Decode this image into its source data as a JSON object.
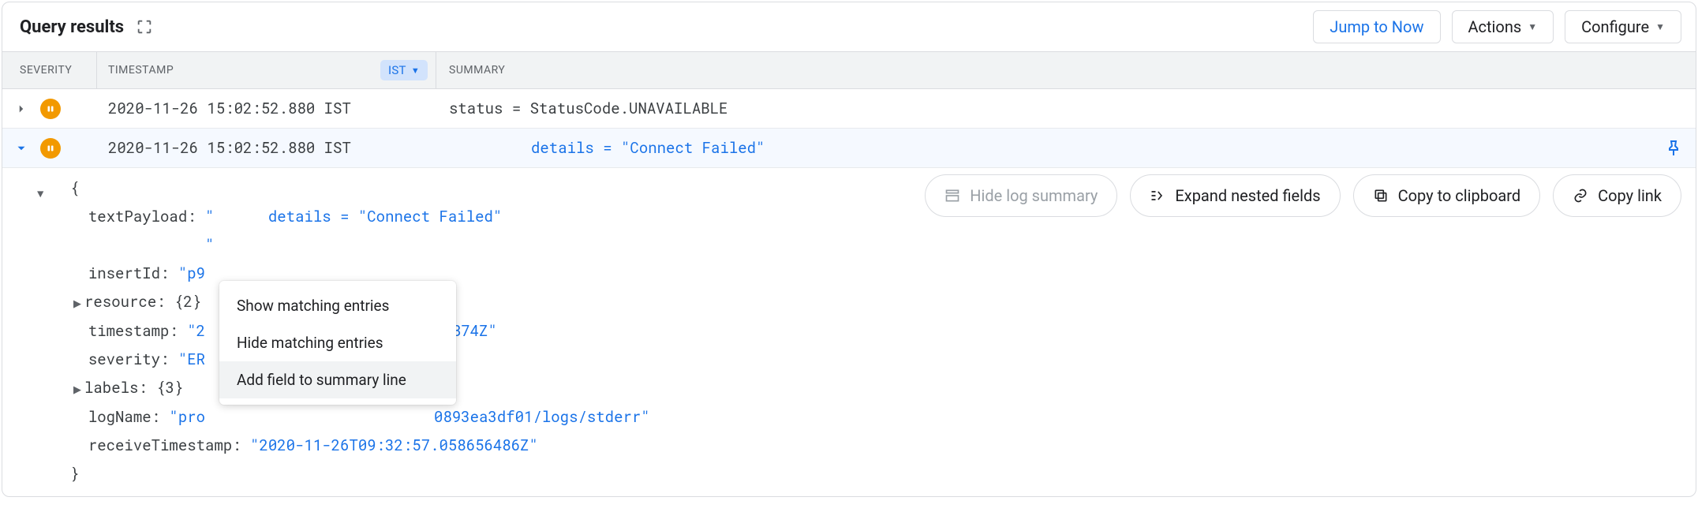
{
  "header": {
    "title": "Query results",
    "jump_label": "Jump to Now",
    "actions_label": "Actions",
    "configure_label": "Configure"
  },
  "columns": {
    "severity": "SEVERITY",
    "timestamp": "TIMESTAMP",
    "timezone": "IST",
    "summary": "SUMMARY"
  },
  "rows": [
    {
      "severity": "error",
      "timestamp": "2020-11-26 15:02:52.880 IST",
      "summary_plain": "status = StatusCode.UNAVAILABLE",
      "expanded": false
    },
    {
      "severity": "error",
      "timestamp": "2020-11-26 15:02:52.880 IST",
      "summary_prefix": "details = ",
      "summary_value": "\"Connect Failed\"",
      "expanded": true
    }
  ],
  "detail_actions": {
    "hide_summary": "Hide log summary",
    "expand_nested": "Expand nested fields",
    "copy_clipboard": "Copy to clipboard",
    "copy_link": "Copy link"
  },
  "json_lines": {
    "open_brace": "{",
    "textPayload_key": "textPayload:",
    "textPayload_quote_open": " \"",
    "textPayload_content": "      details = \"Connect Failed\"",
    "textPayload_quote_close": "\"",
    "insertId_key": "insertId:",
    "insertId_val": " \"p9",
    "resource_key": "resource:",
    "resource_val": " {2}",
    "timestamp_key": "timestamp:",
    "timestamp_val_a": " \"2",
    "timestamp_val_b": "24874Z\"",
    "severity_key": "severity:",
    "severity_val": " \"ER",
    "labels_key": "labels:",
    "labels_val": " {3}",
    "logName_key": "logName:",
    "logName_val_a": " \"pro",
    "logName_val_b": "0893ea3df01/logs/stderr\"",
    "receiveTimestamp_key": "receiveTimestamp:",
    "receiveTimestamp_val": " \"2020-11-26T09:32:57.058656486Z\"",
    "close_brace": "}"
  },
  "context_menu": {
    "show": "Show matching entries",
    "hide": "Hide matching entries",
    "add": "Add field to summary line"
  }
}
